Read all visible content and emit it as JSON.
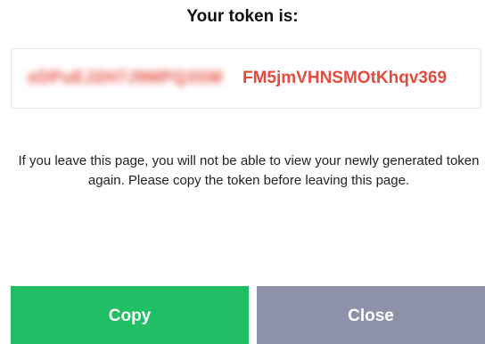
{
  "dialog": {
    "title": "Your token is:",
    "token": {
      "obscured": "eDPuEJ2H7J9MPQ3SM",
      "visible": "FM5jmVHNSMOtKhqv369"
    },
    "warning": "If you leave this page, you will not be able to view your newly generated token again. Please copy the token before leaving this page.",
    "buttons": {
      "copy": "Copy",
      "close": "Close"
    }
  },
  "colors": {
    "token_text": "#e54b3c",
    "copy_button": "#21bf63",
    "close_button": "#8e91aa"
  }
}
